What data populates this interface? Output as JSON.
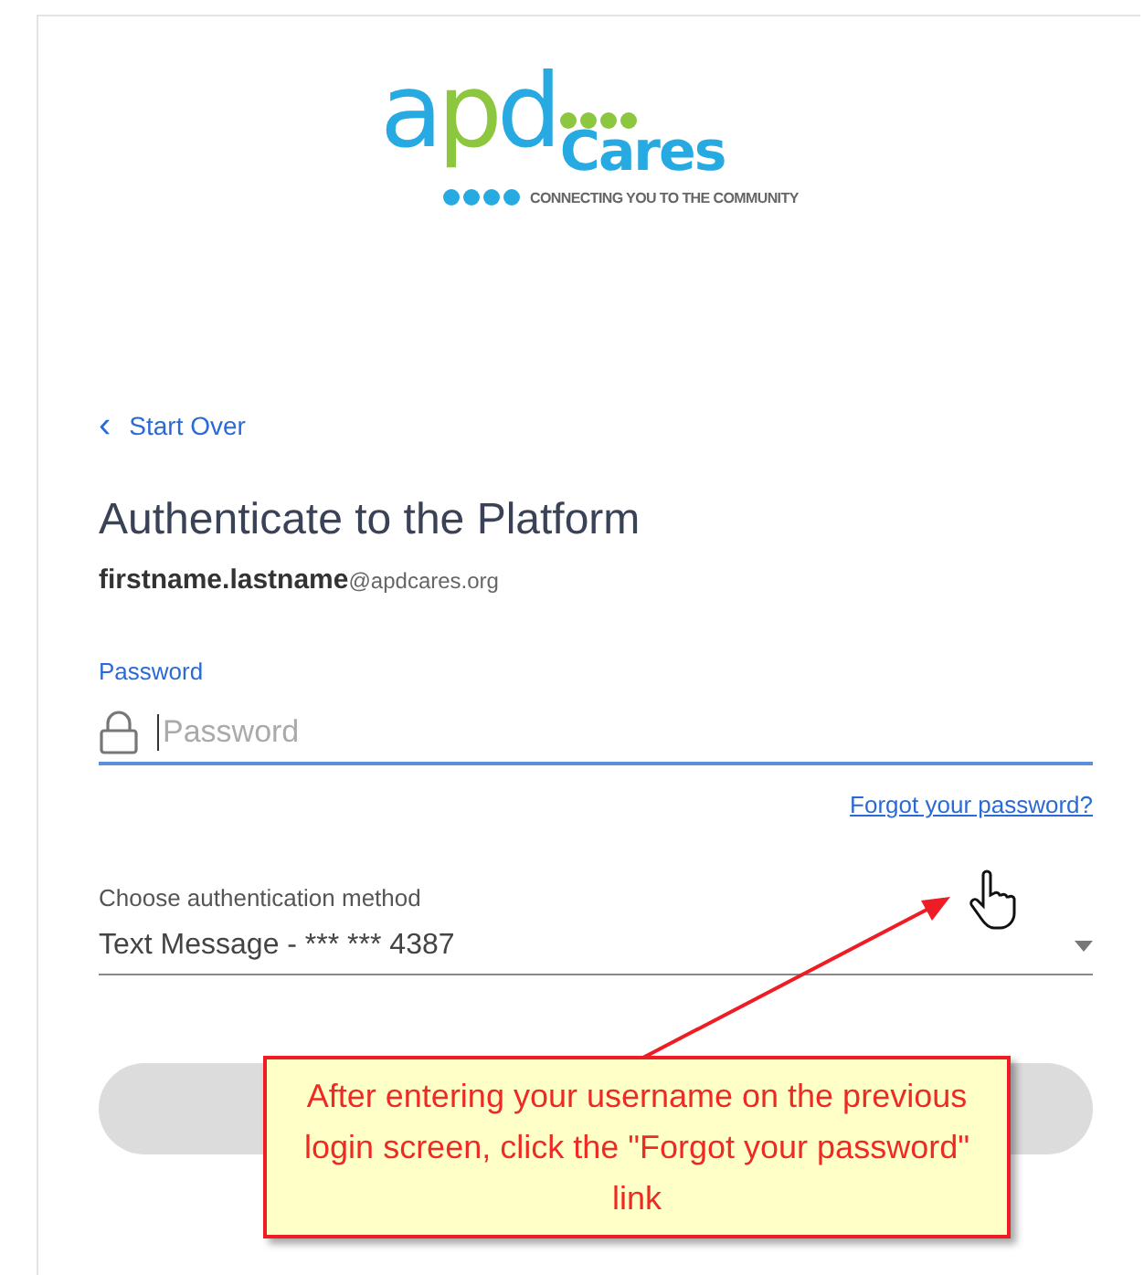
{
  "logo": {
    "brand_prefix": "apd",
    "brand_suffix": "Cares",
    "tagline": "CONNECTING YOU TO THE COMMUNITY"
  },
  "back_link": {
    "icon": "‹",
    "label": "Start Over"
  },
  "heading": "Authenticate to the Platform",
  "account": "**firstname.lastname**@apdcares.org",
  "password": {
    "label": "Password",
    "placeholder": "Password"
  },
  "forgot_link": "Forgot your password?",
  "method": {
    "label": "Choose authentication method",
    "value": "Text Message - *** *** 4387"
  },
  "callout": "After entering your username on the previous login screen, click the \"Forgot your password\" link"
}
